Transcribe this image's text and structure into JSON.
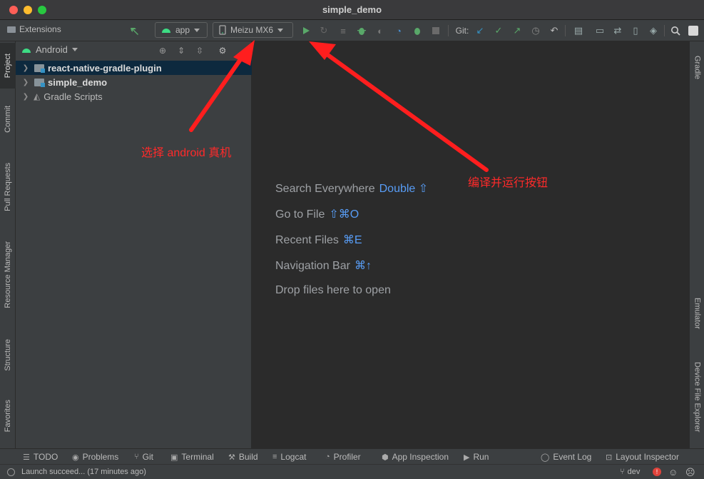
{
  "window": {
    "title": "simple_demo"
  },
  "toolbar": {
    "extensions_label": "Extensions",
    "run_config": "app",
    "device": "Meizu MX6",
    "git_label": "Git:"
  },
  "left_tabs": {
    "project": "Project",
    "commit": "Commit",
    "pull_requests": "Pull Requests",
    "resource_manager": "Resource Manager",
    "structure": "Structure",
    "favorites": "Favorites"
  },
  "right_tabs": {
    "gradle": "Gradle",
    "emulator": "Emulator",
    "device_file_explorer": "Device File Explorer"
  },
  "project_panel": {
    "view_selector": "Android",
    "tree": [
      {
        "label": "react-native-gradle-plugin"
      },
      {
        "label": "simple_demo"
      },
      {
        "label": "Gradle Scripts"
      }
    ]
  },
  "editor_hints": [
    {
      "label": "Search Everywhere",
      "shortcut": "Double ⇧"
    },
    {
      "label": "Go to File",
      "shortcut": "⇧⌘O"
    },
    {
      "label": "Recent Files",
      "shortcut": "⌘E"
    },
    {
      "label": "Navigation Bar",
      "shortcut": "⌘↑"
    },
    {
      "label": "Drop files here to open",
      "shortcut": ""
    }
  ],
  "annotations": {
    "select_device": "选择 android 真机",
    "run_button": "编译并运行按钮",
    "color": "#ff2a2a"
  },
  "bottom_tabs": {
    "todo": "TODO",
    "problems": "Problems",
    "git": "Git",
    "terminal": "Terminal",
    "build": "Build",
    "logcat": "Logcat",
    "profiler": "Profiler",
    "app_inspection": "App Inspection",
    "run": "Run",
    "event_log": "Event Log",
    "layout_inspector": "Layout Inspector"
  },
  "status": {
    "message": "Launch succeed... (17 minutes ago)",
    "branch": "dev"
  }
}
